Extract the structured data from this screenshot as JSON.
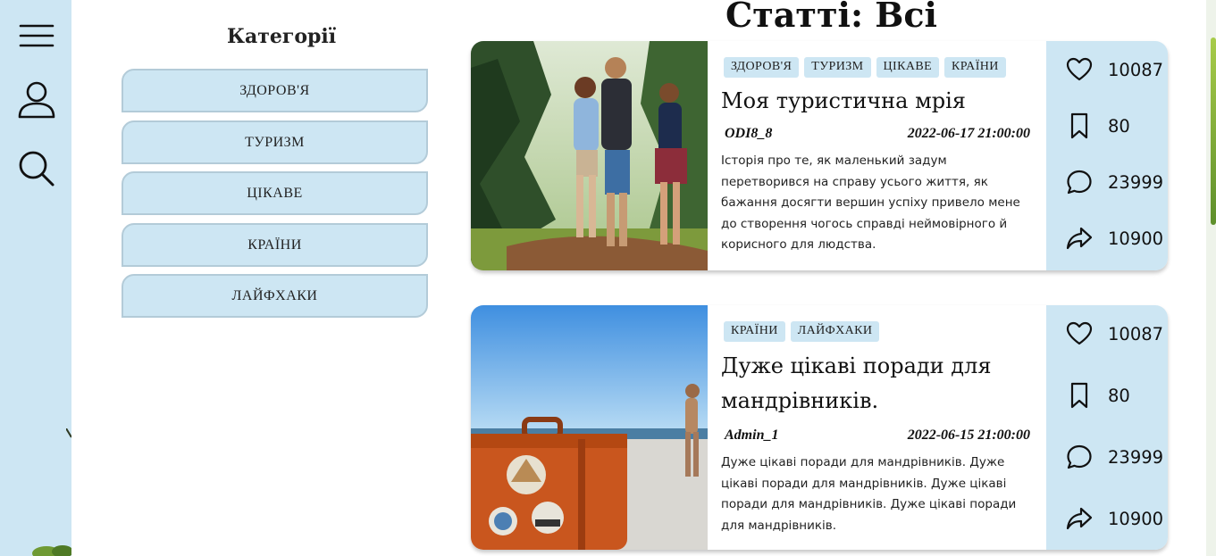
{
  "sidebar": {
    "icons": [
      "menu-icon",
      "user-icon",
      "search-icon"
    ]
  },
  "categories": {
    "title": "Категорії",
    "items": [
      {
        "label": "ЗДОРОВ'Я"
      },
      {
        "label": "ТУРИЗМ"
      },
      {
        "label": "ЦІКАВЕ"
      },
      {
        "label": "КРАЇНИ"
      },
      {
        "label": "ЛАЙФХАКИ"
      }
    ]
  },
  "page": {
    "title": "Статті: Всі"
  },
  "articles": [
    {
      "tags": [
        "ЗДОРОВ'Я",
        "ТУРИЗМ",
        "ЦІКАВЕ",
        "КРАЇНИ"
      ],
      "title": "Моя туристична мрія",
      "author": "ODI8_8",
      "date": "2022-06-17 21:00:00",
      "excerpt": "Історія про те, як маленький задум перетворився на справу усього життя, як бажання досягти вершин успіху привело мене до створення чогось справді неймовірного й корисного для людства.",
      "image": "hikers-photo",
      "stats": {
        "likes": "10087",
        "saves": "80",
        "comments": "23999",
        "shares": "10900"
      }
    },
    {
      "tags": [
        "КРАЇНИ",
        "ЛАЙФХАКИ"
      ],
      "title": "Дуже цікаві поради для мандрівників.",
      "author": "Admin_1",
      "date": "2022-06-15 21:00:00",
      "excerpt": "Дуже цікаві поради для мандрівників. Дуже цікаві поради для мандрівників. Дуже цікаві поради для мандрівників. Дуже цікаві поради для мандрівників.",
      "image": "suitcase-beach-photo",
      "stats": {
        "likes": "10087",
        "saves": "80",
        "comments": "23999",
        "shares": "10900"
      }
    }
  ],
  "colors": {
    "accent": "#cde6f3",
    "panel": "#ffffff",
    "border": "#b3cbd8",
    "text": "#111111"
  }
}
